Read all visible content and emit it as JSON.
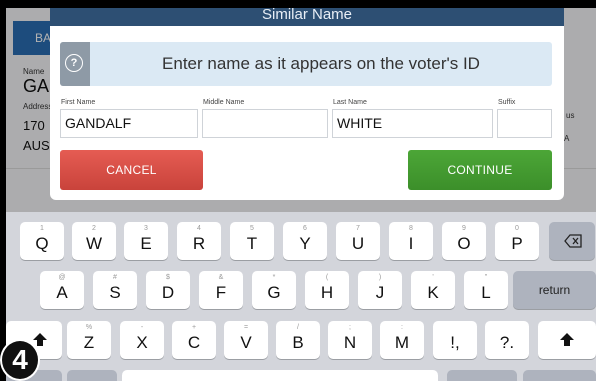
{
  "background": {
    "button_label": "BA",
    "name_label": "Name",
    "name_value": "GA",
    "address_label": "Address",
    "address_line1": "170",
    "address_line2": "AUS",
    "right_partial_1": "us",
    "right_partial_2": "A"
  },
  "modal": {
    "title": "Similar Name",
    "prompt_icon": "?",
    "prompt_text": "Enter name as it appears on the voter's ID",
    "fields": {
      "first_name_label": "First Name",
      "first_name_value": "GANDALF",
      "middle_name_label": "Middle Name",
      "middle_name_value": "",
      "last_name_label": "Last Name",
      "last_name_value": "WHITE",
      "suffix_label": "Suffix",
      "suffix_value": ""
    },
    "cancel_label": "CANCEL",
    "continue_label": "CONTINUE"
  },
  "keyboard": {
    "row1": [
      {
        "alt": "1",
        "main": "Q"
      },
      {
        "alt": "2",
        "main": "W"
      },
      {
        "alt": "3",
        "main": "E"
      },
      {
        "alt": "4",
        "main": "R"
      },
      {
        "alt": "5",
        "main": "T"
      },
      {
        "alt": "6",
        "main": "Y"
      },
      {
        "alt": "7",
        "main": "U"
      },
      {
        "alt": "8",
        "main": "I"
      },
      {
        "alt": "9",
        "main": "O"
      },
      {
        "alt": "0",
        "main": "P"
      }
    ],
    "row2": [
      {
        "alt": "@",
        "main": "A"
      },
      {
        "alt": "#",
        "main": "S"
      },
      {
        "alt": "$",
        "main": "D"
      },
      {
        "alt": "&",
        "main": "F"
      },
      {
        "alt": "*",
        "main": "G"
      },
      {
        "alt": "(",
        "main": "H"
      },
      {
        "alt": ")",
        "main": "J"
      },
      {
        "alt": "'",
        "main": "K"
      },
      {
        "alt": "\"",
        "main": "L"
      }
    ],
    "return_label": "return",
    "row3": [
      {
        "alt": "%",
        "main": "Z"
      },
      {
        "alt": "-",
        "main": "X"
      },
      {
        "alt": "+",
        "main": "C"
      },
      {
        "alt": "=",
        "main": "V"
      },
      {
        "alt": "/",
        "main": "B"
      },
      {
        "alt": ";",
        "main": "N"
      },
      {
        "alt": ":",
        "main": "M"
      },
      {
        "alt": "",
        "main": "!,"
      },
      {
        "alt": "",
        "main": "?."
      }
    ],
    "delete_icon": "delete-icon",
    "shift_icon": "shift-icon"
  },
  "step_badge": "4",
  "colors": {
    "header": "#2d4f73",
    "cancel": "#d44d45",
    "continue": "#43992f",
    "prompt_bg": "#dbe9f4"
  }
}
